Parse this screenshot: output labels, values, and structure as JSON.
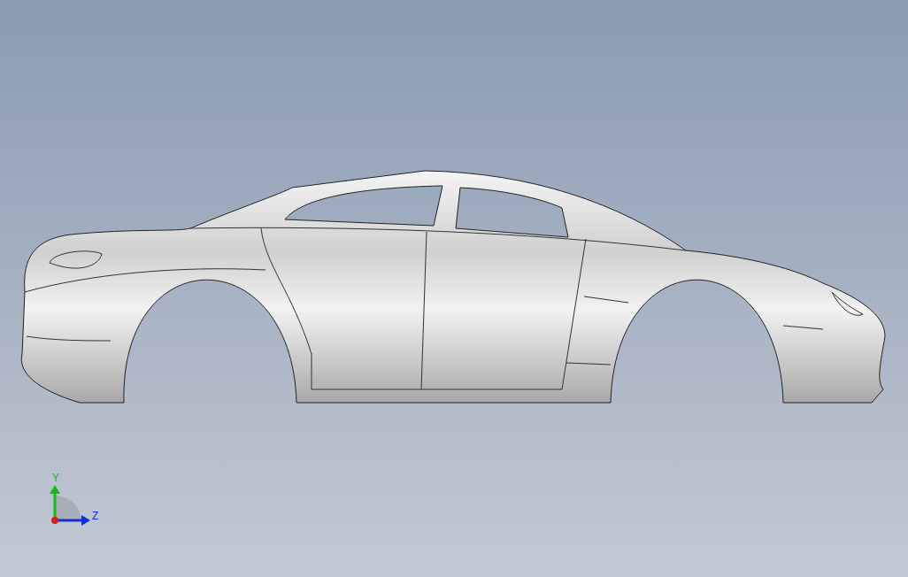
{
  "viewport": {
    "triad": {
      "labels": [
        {
          "kind": "vertical",
          "text": "Y"
        },
        {
          "kind": "horizontal",
          "text": "Z"
        }
      ]
    }
  }
}
